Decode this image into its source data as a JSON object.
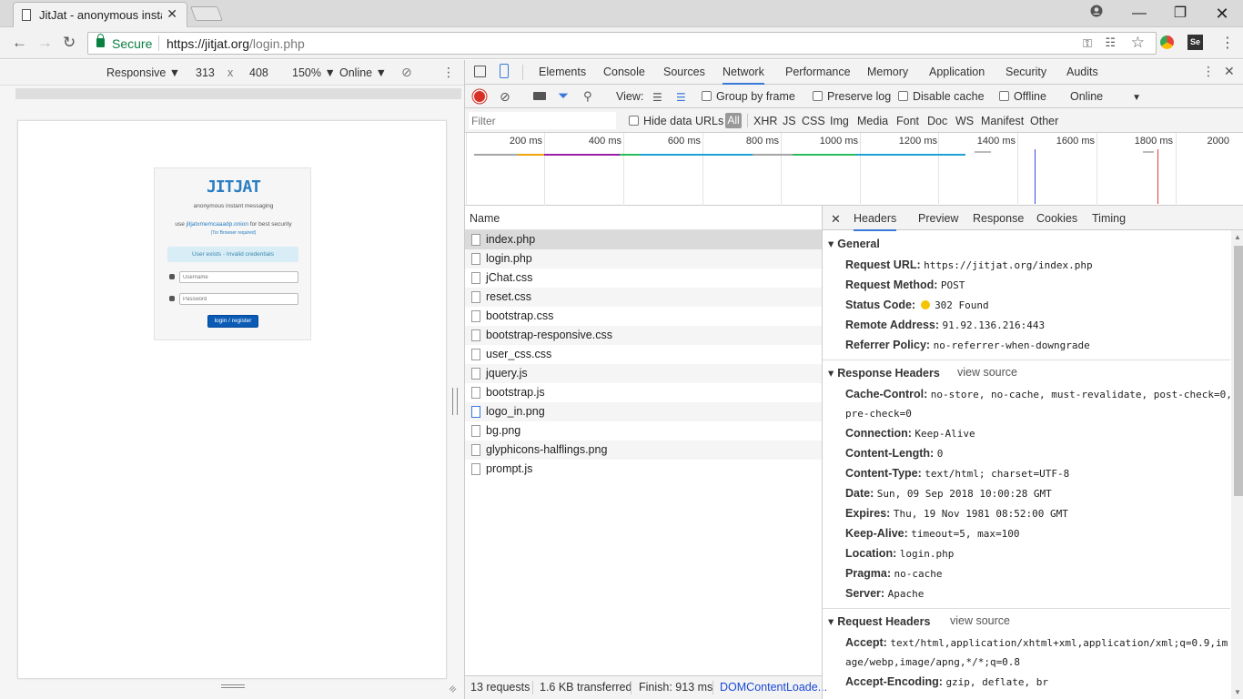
{
  "browser": {
    "tab_title": "JitJat - anonymous instan",
    "security_label": "Secure",
    "url_host": "https://jitjat.org",
    "url_path": "/login.php"
  },
  "device_toolbar": {
    "mode": "Responsive ▼",
    "width": "313",
    "times": "x",
    "height": "408",
    "zoom": "150% ▼",
    "network": "Online ▼"
  },
  "page": {
    "logo": "JITJAT",
    "tagline": "anonymous instant messaging",
    "use_prefix": "use",
    "onion_link": "jitjatxmemcaaadp.onion",
    "use_suffix": "for best security",
    "tor_note": "(Tor Browser required)",
    "alert": "User exists - Invalid credentials",
    "username_placeholder": "Username",
    "password_placeholder": "Password",
    "login_button": "login / register"
  },
  "devtools": {
    "tabs": [
      "Elements",
      "Console",
      "Sources",
      "Network",
      "Performance",
      "Memory",
      "Application",
      "Security",
      "Audits"
    ],
    "toolbar": {
      "view_label": "View:",
      "group_by_frame": "Group by frame",
      "preserve_log": "Preserve log",
      "disable_cache": "Disable cache",
      "offline": "Offline",
      "online": "Online"
    },
    "filter": {
      "placeholder": "Filter",
      "hide_data_urls": "Hide data URLs",
      "types": [
        "All",
        "XHR",
        "JS",
        "CSS",
        "Img",
        "Media",
        "Font",
        "Doc",
        "WS",
        "Manifest",
        "Other"
      ]
    },
    "timeline_labels": [
      "200 ms",
      "400 ms",
      "600 ms",
      "800 ms",
      "1000 ms",
      "1200 ms",
      "1400 ms",
      "1600 ms",
      "1800 ms",
      "2000"
    ],
    "name_header": "Name",
    "requests": [
      "index.php",
      "login.php",
      "jChat.css",
      "reset.css",
      "bootstrap.css",
      "bootstrap-responsive.css",
      "user_css.css",
      "jquery.js",
      "bootstrap.js",
      "logo_in.png",
      "bg.png",
      "glyphicons-halflings.png",
      "prompt.js"
    ],
    "status": {
      "requests": "13 requests",
      "transferred": "1.6 KB transferred",
      "finish": "Finish: 913 ms",
      "dom": "DOMContentLoade..."
    },
    "detail_tabs": [
      "Headers",
      "Preview",
      "Response",
      "Cookies",
      "Timing"
    ],
    "general_title": "General",
    "general": [
      {
        "k": "Request URL:",
        "v": "https://jitjat.org/index.php"
      },
      {
        "k": "Request Method:",
        "v": "POST"
      },
      {
        "k": "Status Code:",
        "v": "302 Found"
      },
      {
        "k": "Remote Address:",
        "v": "91.92.136.216:443"
      },
      {
        "k": "Referrer Policy:",
        "v": "no-referrer-when-downgrade"
      }
    ],
    "response_title": "Response Headers",
    "view_source": "view source",
    "response": [
      {
        "k": "Cache-Control:",
        "v": "no-store, no-cache, must-revalidate, post-check=0,"
      },
      {
        "k": "",
        "v": "pre-check=0"
      },
      {
        "k": "Connection:",
        "v": "Keep-Alive"
      },
      {
        "k": "Content-Length:",
        "v": "0"
      },
      {
        "k": "Content-Type:",
        "v": "text/html; charset=UTF-8"
      },
      {
        "k": "Date:",
        "v": "Sun, 09 Sep 2018 10:00:28 GMT"
      },
      {
        "k": "Expires:",
        "v": "Thu, 19 Nov 1981 08:52:00 GMT"
      },
      {
        "k": "Keep-Alive:",
        "v": "timeout=5, max=100"
      },
      {
        "k": "Location:",
        "v": "login.php"
      },
      {
        "k": "Pragma:",
        "v": "no-cache"
      },
      {
        "k": "Server:",
        "v": "Apache"
      }
    ],
    "request_title": "Request Headers",
    "request": [
      {
        "k": "Accept:",
        "v": "text/html,application/xhtml+xml,application/xml;q=0.9,im"
      },
      {
        "k": "",
        "v": "age/webp,image/apng,*/*;q=0.8"
      },
      {
        "k": "Accept-Encoding:",
        "v": "gzip, deflate, br"
      }
    ]
  }
}
